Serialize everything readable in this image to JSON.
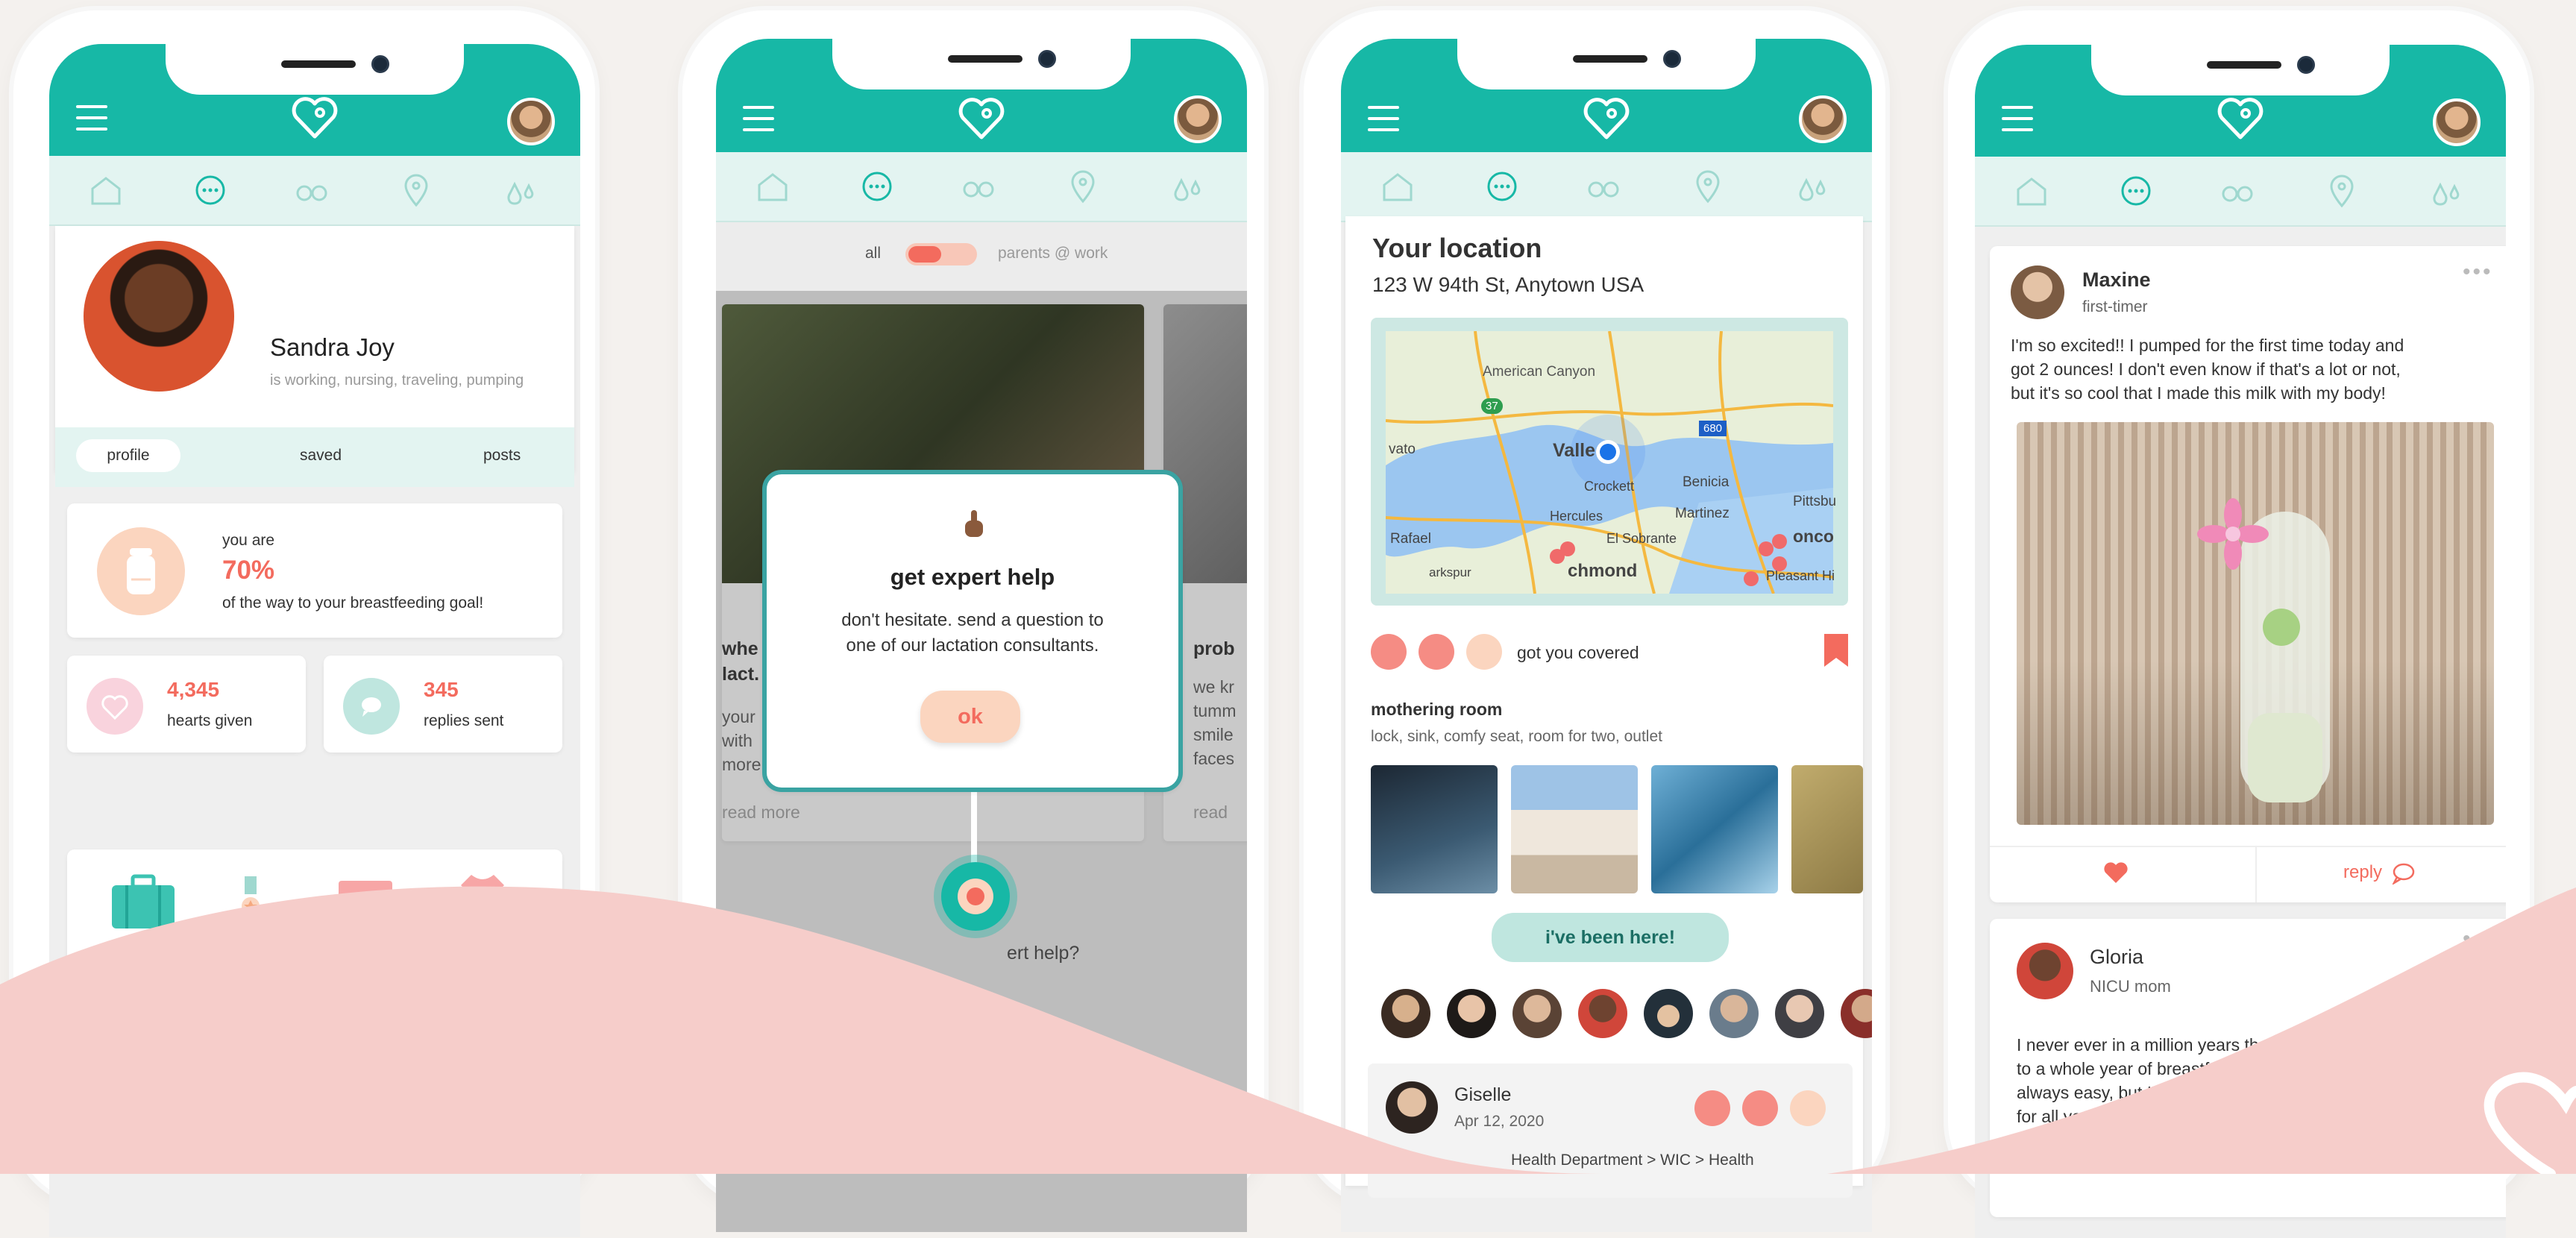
{
  "tabs": [
    "home",
    "chat",
    "explore",
    "location",
    "milk"
  ],
  "colors": {
    "teal": "#17b8a6",
    "coral": "#f36b5e",
    "peach": "#fbd5bf",
    "pink_wave": "#f6cdca",
    "mint": "#e3f4f1"
  },
  "screen1": {
    "name": "Sandra Joy",
    "status": "is working, nursing, traveling, pumping",
    "profile_tabs": [
      "profile",
      "saved",
      "posts"
    ],
    "goal_prefix": "you are",
    "goal_percent": "70%",
    "goal_suffix": "of the way to your breastfeeding goal!",
    "hearts_count": "4,345",
    "hearts_label": "hearts given",
    "replies_count": "345",
    "replies_label": "replies sent",
    "badges": [
      "traveling",
      "military"
    ]
  },
  "screen2": {
    "filter_left": "all",
    "filter_right": "parents @ work",
    "modal_title": "get expert help",
    "modal_body_1": "don't hesitate. send a question to",
    "modal_body_2": "one of our lactation consultants.",
    "ok_button": "ok",
    "card1_title_1": "whe",
    "card1_title_2": "lact.",
    "card1_body": [
      "your",
      "with",
      "more"
    ],
    "card1_link": "read more",
    "card2_title": "prob",
    "card2_body": [
      "we kr",
      "tumm",
      "smile",
      "faces"
    ],
    "card2_link": "read",
    "bottom_text": "ert help?"
  },
  "screen3": {
    "location_title": "Your location",
    "address": "123 W 94th St, Anytown USA",
    "map_labels": [
      "American Canyon",
      "Valle",
      "Crockett",
      "Benicia",
      "Martinez",
      "Hercules",
      "El Sobrante",
      "Rafael",
      "arkspur",
      "chmond",
      "Pittsbu",
      "onco",
      "Pleasant Hi",
      "vato"
    ],
    "highway_labels": [
      "37",
      "680"
    ],
    "covered_label": "got you covered",
    "room_title": "mothering room",
    "room_features": "lock, sink, comfy seat, room for two, outlet",
    "been_here_button": "i've been here!",
    "review_name": "Giselle",
    "review_date": "Apr 12, 2020",
    "review_path": "Health Department > WIC > Health"
  },
  "screen4": {
    "post1_name": "Maxine",
    "post1_role": "first-timer",
    "post1_text_1": "I'm so excited!! I pumped for the first time today and",
    "post1_text_2": "got 2 ounces! I don't even know if that's a lot or not,",
    "post1_text_3": "but it's so cool that I made this milk with my body!",
    "reply_label": "reply",
    "post2_name": "Gloria",
    "post2_role": "NICU mom",
    "post2_text_1": "I never ever in a million years thougl",
    "post2_text_2": "to a whole year of breastfeedin",
    "post2_text_3": "always easy, but I'm so gl",
    "post2_text_4": "for all your cheeri"
  }
}
